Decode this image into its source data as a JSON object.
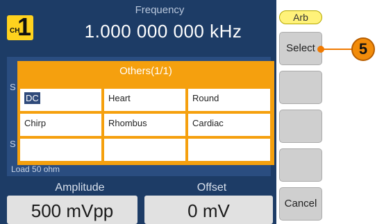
{
  "channel": {
    "prefix": "CH",
    "number": "1"
  },
  "frequency": {
    "label": "Frequency",
    "value": "1.000 000 000 kHz"
  },
  "dialog": {
    "title": "Others(1/1)",
    "options": [
      {
        "label": "DC",
        "selected": true
      },
      {
        "label": "Heart",
        "selected": false
      },
      {
        "label": "Round",
        "selected": false
      },
      {
        "label": "Chirp",
        "selected": false
      },
      {
        "label": "Rhombus",
        "selected": false
      },
      {
        "label": "Cardiac",
        "selected": false
      },
      {
        "label": "",
        "selected": false
      },
      {
        "label": "",
        "selected": false
      },
      {
        "label": "",
        "selected": false
      }
    ]
  },
  "background_text": {
    "load": "Load 50 ohm",
    "left_s1": "S",
    "left_s2": "S"
  },
  "amplitude": {
    "label": "Amplitude",
    "value": "500 mVpp"
  },
  "offset": {
    "label": "Offset",
    "value": "0 mV"
  },
  "softkeys": {
    "mode": "Arb",
    "select": "Select",
    "cancel": "Cancel"
  },
  "callout": {
    "number": "5"
  },
  "colors": {
    "screen_bg": "#1d3c66",
    "dialog": "#f5a00e",
    "channel_badge": "#ffd21e",
    "callout": "#f28c0a"
  }
}
